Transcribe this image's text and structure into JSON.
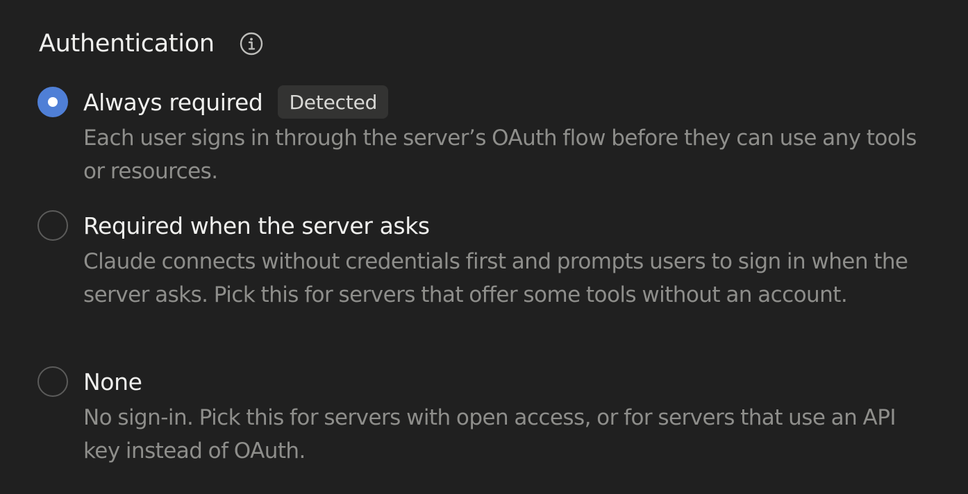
{
  "section": {
    "title": "Authentication",
    "info_icon": "info-icon"
  },
  "options": [
    {
      "label": "Always required",
      "badge": "Detected",
      "description": "Each user signs in through the server’s OAuth flow before they can use any tools or resources.",
      "selected": true
    },
    {
      "label": "Required when the server asks",
      "description": "Claude connects without credentials first and prompts users to sign in when the server asks. Pick this for servers that offer some tools without an account.",
      "selected": false
    },
    {
      "label": "None",
      "description": "No sign-in. Pick this for servers with open access, or for servers that use an API key instead of OAuth.",
      "selected": false
    }
  ],
  "colors": {
    "background": "#202020",
    "accent": "#4f7fd6",
    "text_primary": "#f0f0ee",
    "text_secondary": "#8e8e8b",
    "badge_bg": "#333332"
  }
}
